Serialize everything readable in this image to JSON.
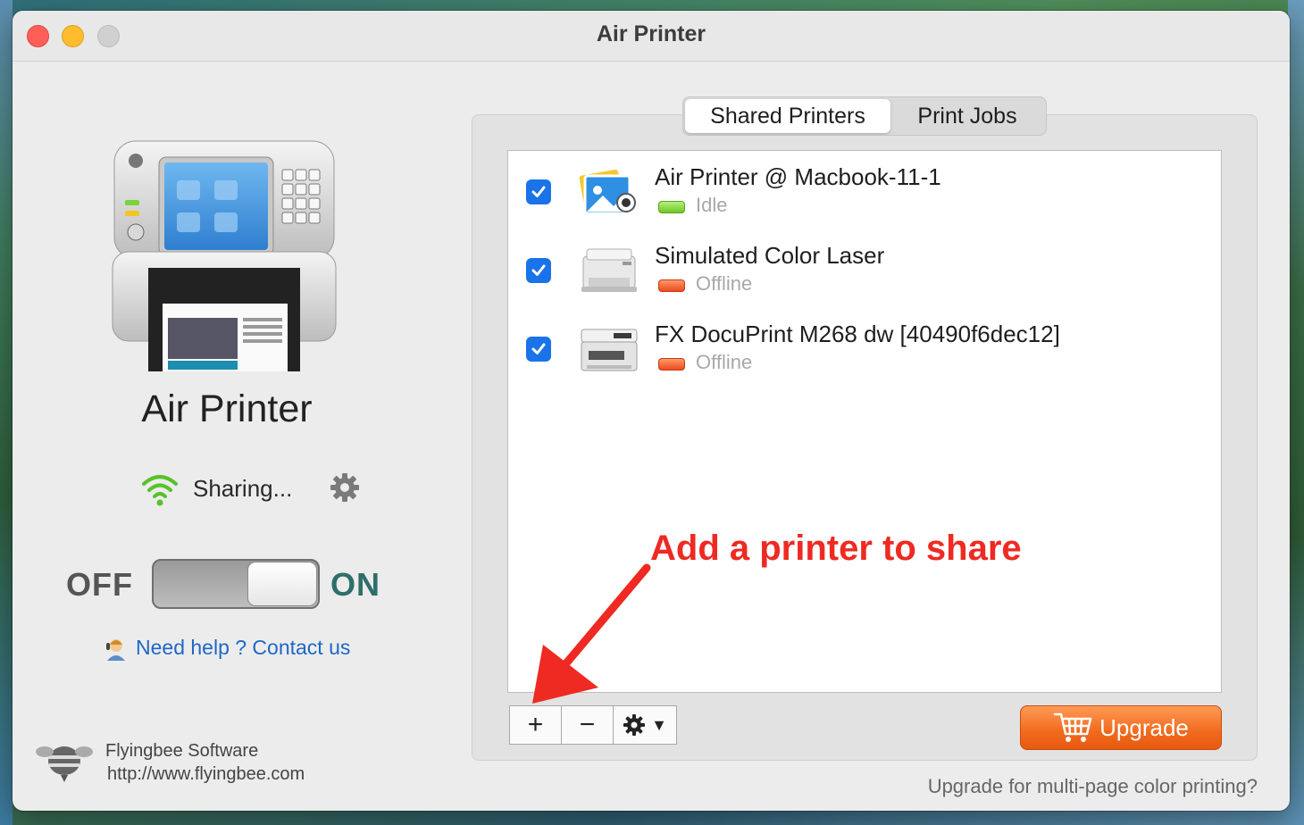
{
  "window": {
    "title": "Air Printer"
  },
  "left": {
    "app_name": "Air Printer",
    "sharing_status": "Sharing...",
    "toggle": {
      "off_label": "OFF",
      "on_label": "ON",
      "state": "on"
    },
    "help_link": "Need help ? Contact us",
    "company": {
      "name": "Flyingbee Software",
      "url": "http://www.flyingbee.com"
    }
  },
  "tabs": [
    {
      "label": "Shared Printers",
      "active": true
    },
    {
      "label": "Print Jobs",
      "active": false
    }
  ],
  "printers": [
    {
      "name": "Air Printer @ Macbook-11-1",
      "status": "Idle",
      "status_color": "#6fc628",
      "checked": true,
      "icon": "photo-printer-icon"
    },
    {
      "name": "Simulated Color Laser",
      "status": "Offline",
      "status_color": "#ec4a1e",
      "checked": true,
      "icon": "laser-printer-icon"
    },
    {
      "name": "FX DocuPrint M268 dw [40490f6dec12]",
      "status": "Offline",
      "status_color": "#ec4a1e",
      "checked": true,
      "icon": "multifunction-printer-icon"
    }
  ],
  "toolbar": {
    "add_label": "+",
    "remove_label": "−",
    "action_caret": "▼"
  },
  "annotation": "Add a printer to share",
  "upgrade": {
    "button_label": "Upgrade",
    "note": "Upgrade for multi-page color printing?"
  },
  "colors": {
    "accent_blue": "#1a73e8",
    "link_blue": "#1e67c8",
    "annotation_red": "#ee2a22",
    "upgrade_orange": "#f06a1e",
    "on_teal": "#2d6f6a"
  }
}
